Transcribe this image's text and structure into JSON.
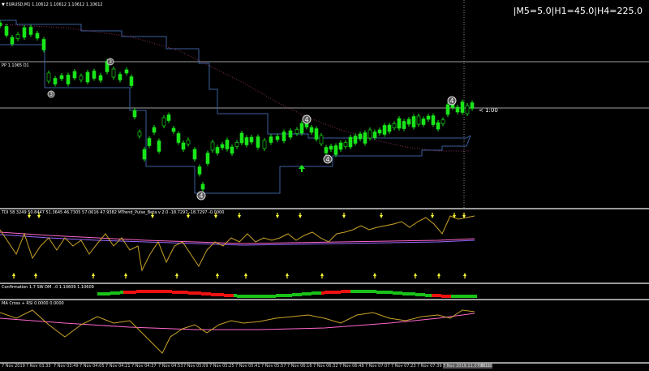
{
  "window": {
    "symbol_line": "▼ EURUSD,M1  1.10612 1.10612 1.10612 1.10612",
    "timeframes": "|M5=5.0|H1=45.0|H4=225.0"
  },
  "main_chart": {
    "pivot_label": "PP 1.1065 D1",
    "current_price_tag": "< 1:00",
    "swing_markers": [
      "3",
      "3",
      "4",
      "4",
      "4",
      "4"
    ]
  },
  "indicators": {
    "td_label": "TDI 58.3249 50.8447 51.3645 46.7305 57.0616 47.9382 MTrend_Pulse_Beta v 2.0 -18.7297 -18.7297 -0.0000",
    "confirmation_label": "Confirmation 1.7 SW DM ..0 1.10609 1.10609",
    "macross_label": "MA Cross + RSI 0.0000 0.0000"
  },
  "time_axis": {
    "ticks": [
      "7 Nov 2019",
      "7 Nov 03:33",
      "7 Nov 03:49",
      "7 Nov 04:05",
      "7 Nov 04:21",
      "7 Nov 04:37",
      "7 Nov 04:53",
      "7 Nov 05:09",
      "7 Nov 05:25",
      "7 Nov 05:41",
      "7 Nov 05:57",
      "7 Nov 06:16",
      "7 Nov 06:32",
      "7 Nov 06:48",
      "7 Nov 07:07",
      "7 Nov 07:23",
      "7 Nov 07:39",
      "7 Nov 2019.11.07 08:00",
      "08:11"
    ]
  },
  "colors": {
    "bull_candle": "#19e619",
    "channel": "#3a5f9e",
    "ma_dotted": "#8a2f5a",
    "hline": "#a0a0a0",
    "arrow": "#ffff33",
    "up_arrow": "#19e619",
    "tdi_gold": "#c9a227",
    "tdi_pink": "#ff66cc",
    "conf_green": "#19c219",
    "conf_red": "#ee1111"
  }
}
